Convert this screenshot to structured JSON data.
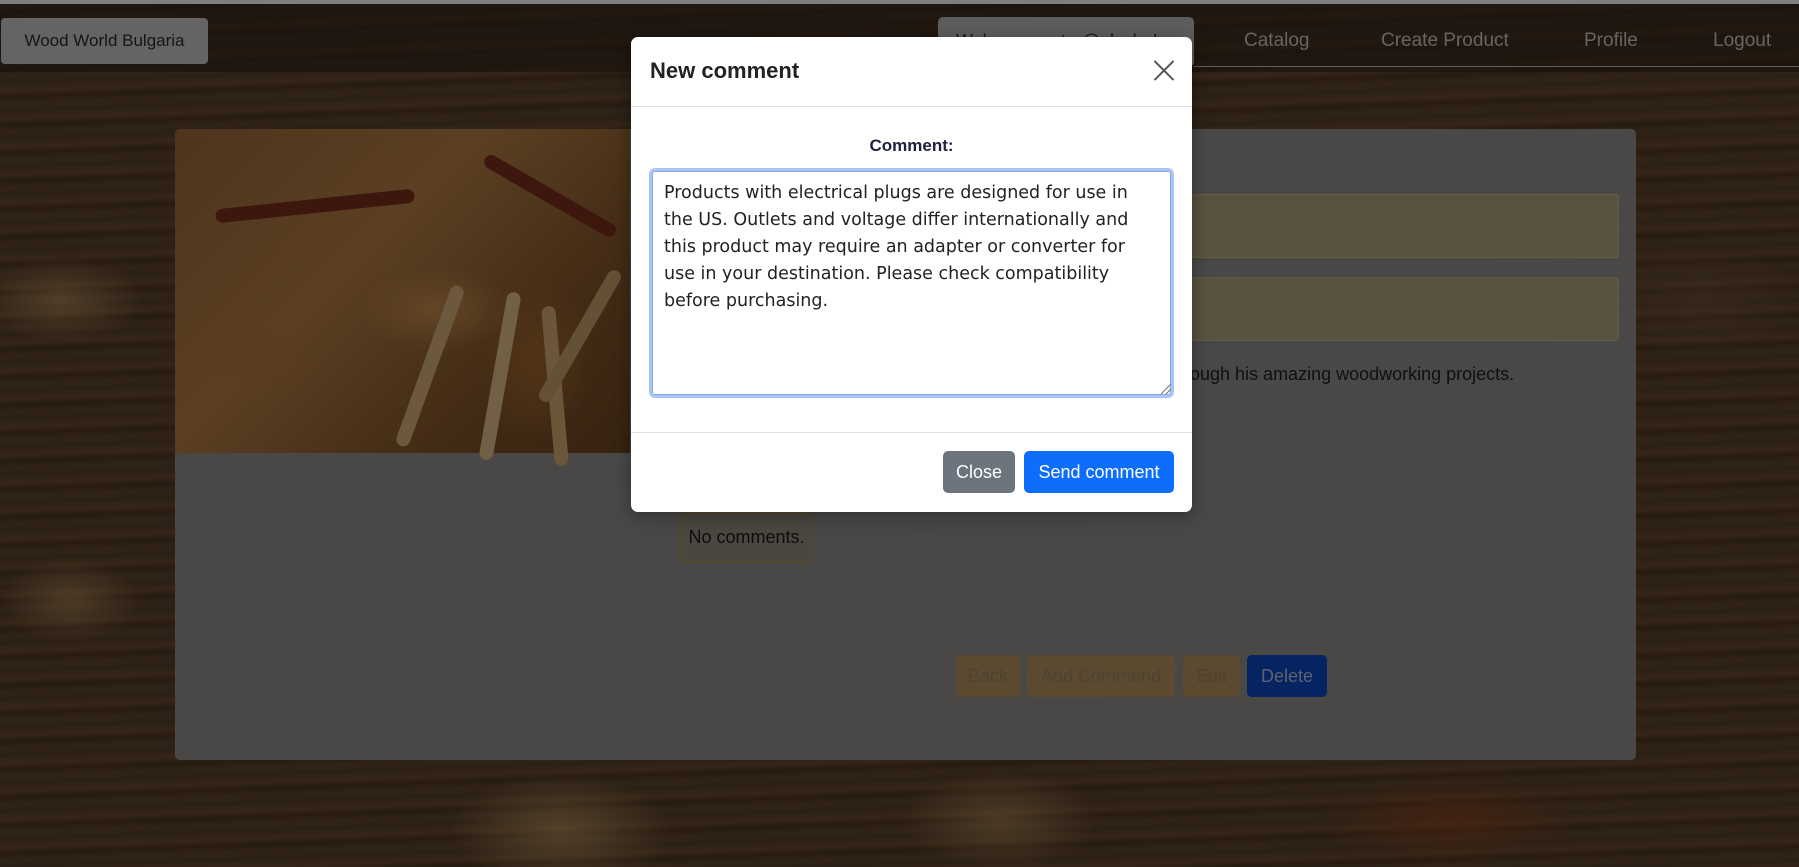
{
  "navbar": {
    "brand": "Wood World Bulgaria",
    "welcome": "Welcome, peter@abv.bg!",
    "links": [
      "Catalog",
      "Create Product",
      "Profile",
      "Logout"
    ]
  },
  "product": {
    "description_visible": "ough his amazing woodworking projects.",
    "comments_empty": "No comments.",
    "actions": [
      "Back",
      "Add Commend",
      "Edit",
      "Delete"
    ]
  },
  "modal": {
    "title": "New comment",
    "label": "Comment:",
    "comment_value": "Products with electrical plugs are designed for use in the US. Outlets and voltage differ internationally and this product may require an adapter or converter for use in your destination. Please check compatibility before purchasing.",
    "close_label": "Close",
    "send_label": "Send comment"
  },
  "colors": {
    "primary": "#0d6efd",
    "secondary": "#6c757d",
    "warning_muted": "#b89560"
  }
}
